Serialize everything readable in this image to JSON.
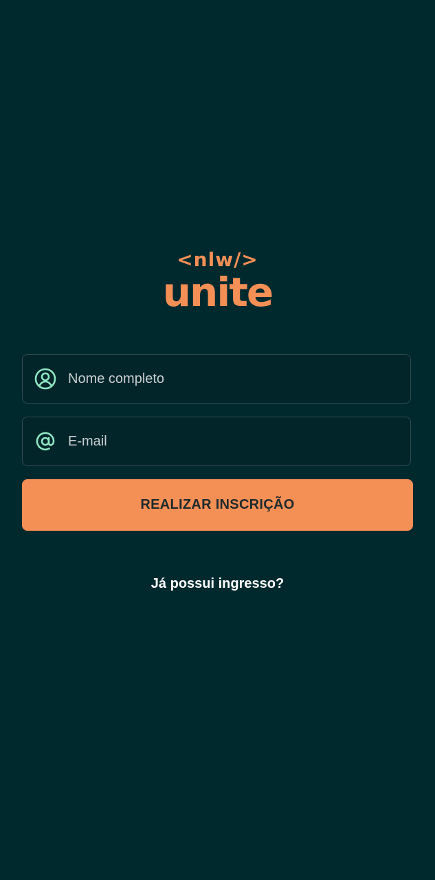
{
  "logo": {
    "tag": "<nlw/>",
    "name": "unite"
  },
  "form": {
    "name_placeholder": "Nome completo",
    "email_placeholder": "E-mail",
    "name_value": "",
    "email_value": "",
    "name_icon": "user-circle-icon",
    "email_icon": "at-sign-icon",
    "submit_label": "REALIZAR INSCRIÇÃO"
  },
  "footer": {
    "link_label": "Já possui ingresso?"
  },
  "colors": {
    "background": "#00292e",
    "accent": "#f48f56",
    "icon": "#8ee6c2"
  }
}
